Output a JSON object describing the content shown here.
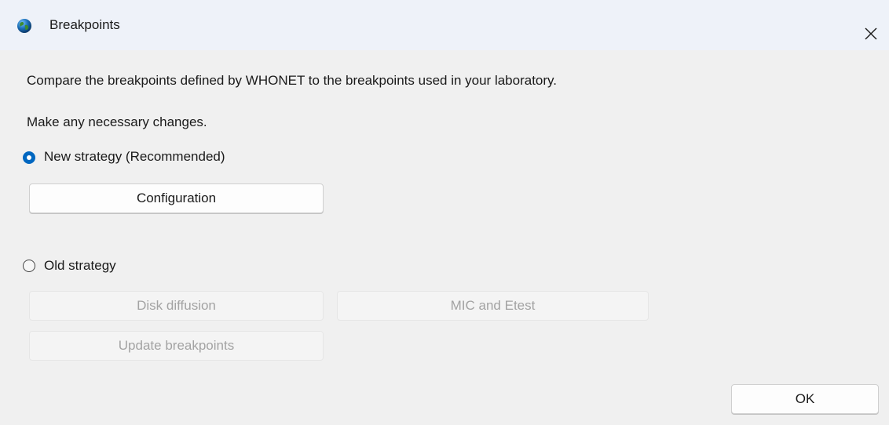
{
  "window": {
    "title": "Breakpoints",
    "icon": "globe-icon",
    "close_glyph": "✕"
  },
  "dialog": {
    "intro_text": "Compare the breakpoints defined by WHONET to the breakpoints used in your laboratory.",
    "instruction_text": "Make any necessary changes.",
    "new_strategy": {
      "label": "New strategy (Recommended)",
      "selected": true,
      "configuration_button": "Configuration"
    },
    "old_strategy": {
      "label": "Old strategy",
      "selected": false,
      "disk_diffusion_button": "Disk diffusion",
      "mic_etest_button": "MIC and Etest",
      "update_breakpoints_button": "Update breakpoints"
    },
    "ok_button": "OK"
  },
  "colors": {
    "accent": "#0067c0",
    "disabled_text": "#a3a3a3",
    "title_bar": "#eef2f9",
    "background": "#f0f0f0"
  }
}
